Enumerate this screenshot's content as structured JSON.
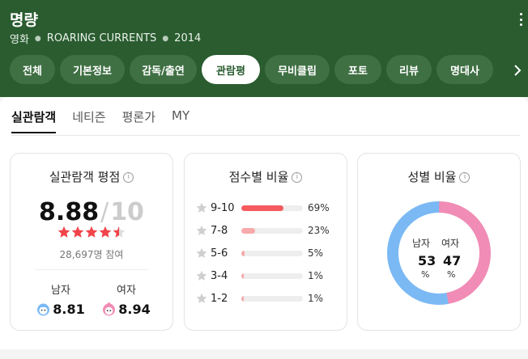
{
  "header": {
    "title": "명량",
    "meta": [
      "영화",
      "ROARING CURRENTS",
      "2014"
    ]
  },
  "tabs": [
    {
      "label": "전체"
    },
    {
      "label": "기본정보"
    },
    {
      "label": "감독/출연"
    },
    {
      "label": "관람평"
    },
    {
      "label": "무비클립"
    },
    {
      "label": "포토"
    },
    {
      "label": "리뷰"
    },
    {
      "label": "명대사"
    }
  ],
  "active_tab": "관람평",
  "subtabs": [
    {
      "label": "실관람객"
    },
    {
      "label": "네티즌"
    },
    {
      "label": "평론가"
    },
    {
      "label": "MY"
    }
  ],
  "active_subtab": "실관람객",
  "rating_card": {
    "title": "실관람객 평점",
    "score": "8.88",
    "slash": "/",
    "max": "10",
    "star_rating": 4.5,
    "participants": "28,697명 참여",
    "male_label": "남자",
    "male_score": "8.81",
    "female_label": "여자",
    "female_score": "8.94"
  },
  "distribution_card": {
    "title": "점수별 비율",
    "rows": [
      {
        "range": "9-10",
        "percent": 69,
        "label": "69%"
      },
      {
        "range": "7-8",
        "percent": 23,
        "label": "23%"
      },
      {
        "range": "5-6",
        "percent": 5,
        "label": "5%"
      },
      {
        "range": "3-4",
        "percent": 1,
        "label": "1%"
      },
      {
        "range": "1-2",
        "percent": 1,
        "label": "1%"
      }
    ]
  },
  "gender_card": {
    "title": "성별 비율",
    "male_label": "남자",
    "female_label": "여자",
    "male_value": "53",
    "female_value": "47",
    "unit": "%",
    "male_percent": 53,
    "female_percent": 47
  },
  "colors": {
    "header_bg": "#2a5c2f",
    "star": "#f0444a",
    "bar_high": "#f55a5f",
    "bar_low": "#f7a9ab",
    "male": "#7bb9f4",
    "female": "#f08cb5"
  }
}
